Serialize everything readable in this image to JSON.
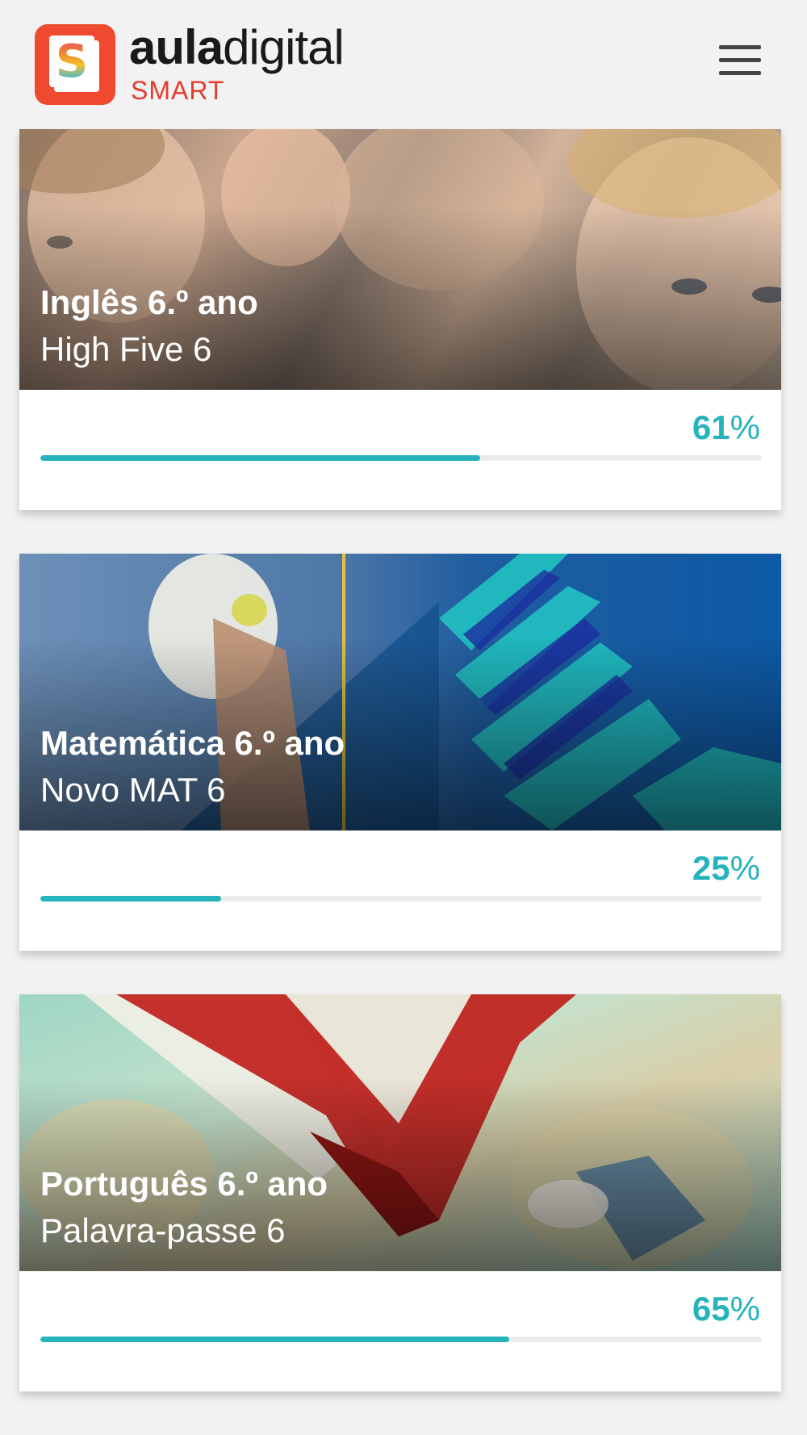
{
  "header": {
    "brand_bold": "aula",
    "brand_light": "digital",
    "brand_sub": "SMART",
    "logo_letter": "S",
    "accent_color": "#ef4a2f",
    "menu_icon": "hamburger-menu-icon"
  },
  "courses": [
    {
      "title": "Inglês 6.º ano",
      "book": "High Five 6",
      "progress_value": "61",
      "progress_unit": "%",
      "progress_fraction": 0.61
    },
    {
      "title": "Matemática 6.º ano",
      "book": "Novo MAT 6",
      "progress_value": "25",
      "progress_unit": "%",
      "progress_fraction": 0.25
    },
    {
      "title": "Português 6.º ano",
      "book": "Palavra-passe 6",
      "progress_value": "65",
      "progress_unit": "%",
      "progress_fraction": 0.65
    }
  ],
  "colors": {
    "progress": "#26b3bb",
    "track": "#ececec"
  }
}
